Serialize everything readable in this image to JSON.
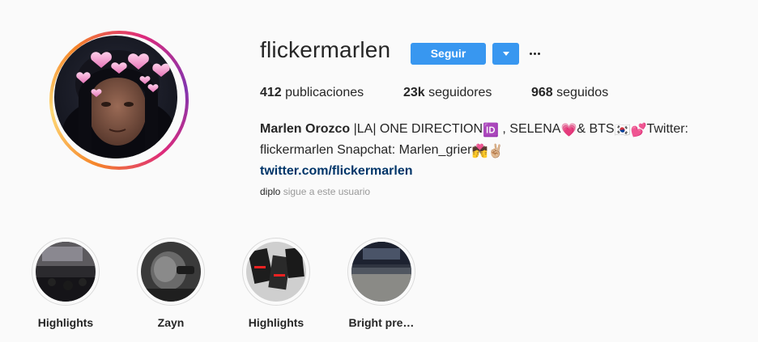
{
  "profile": {
    "username": "flickermarlen",
    "follow_label": "Seguir",
    "posts_count": "412",
    "posts_label": "publicaciones",
    "followers_count": "23k",
    "followers_label": "seguidores",
    "following_count": "968",
    "following_label": "seguidos",
    "bio": {
      "name": "Marlen Orozco",
      "line1_a": " |LA| ONE DIRECTION",
      "emoji_id": "🆔",
      "line1_b": " , SELENA",
      "emoji_heart": "💗",
      "line1_c": "& BTS",
      "emoji_flag": "🇰🇷",
      "emoji_hearts": "💕",
      "line1_d": "Twitter:",
      "line2": "flickermarlen Snapchat: Marlen_grier",
      "emoji_couple": "💏",
      "emoji_victory": "✌🏼",
      "link": "twitter.com/flickermarlen"
    },
    "followed_by_user": "diplo",
    "followed_by_text": " sigue a este usuario"
  },
  "highlights": [
    {
      "label": "Highlights"
    },
    {
      "label": "Zayn"
    },
    {
      "label": "Highlights"
    },
    {
      "label": "Bright pre…"
    }
  ],
  "icons": {
    "dropdown": "chevron-down-icon",
    "more": "more-options-icon"
  },
  "colors": {
    "accent": "#3897f0",
    "link": "#003569",
    "muted": "#999999"
  }
}
